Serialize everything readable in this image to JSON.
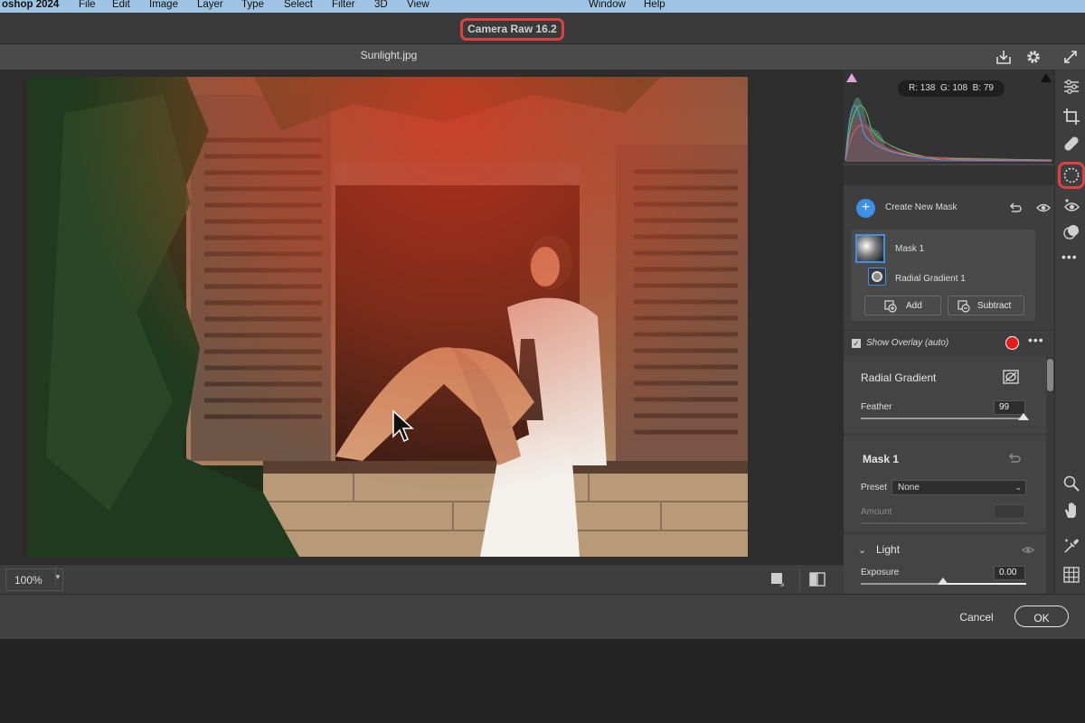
{
  "menubar": {
    "app_name": "oshop 2024",
    "items": [
      "File",
      "Edit",
      "Image",
      "Layer",
      "Type",
      "Select",
      "Filter",
      "3D",
      "View",
      "Window",
      "Help"
    ]
  },
  "window_title": "Camera Raw 16.2",
  "document": {
    "filename": "Sunlight.jpg"
  },
  "status": {
    "zoom": "100%"
  },
  "histogram": {
    "r_label": "R:",
    "r": "138",
    "g_label": "G:",
    "g": "108",
    "b_label": "B:",
    "b": "79"
  },
  "masks": {
    "create_label": "Create New Mask",
    "mask_name": "Mask 1",
    "component": "Radial Gradient 1",
    "add_label": "Add",
    "subtract_label": "Subtract",
    "overlay_label": "Show Overlay (auto)",
    "overlay_color": "#e21b1b"
  },
  "radial": {
    "title": "Radial Gradient",
    "feather_label": "Feather",
    "feather_value": "99",
    "feather_fraction": 0.99
  },
  "mask1": {
    "title": "Mask 1",
    "preset_label": "Preset",
    "preset_value": "None",
    "amount_label": "Amount"
  },
  "light": {
    "title": "Light",
    "exposure_label": "Exposure",
    "exposure_value": "0.00"
  },
  "footer": {
    "cancel": "Cancel",
    "ok": "OK"
  },
  "colors": {
    "accent": "#3d8fe8",
    "highlight": "#e0403f"
  }
}
